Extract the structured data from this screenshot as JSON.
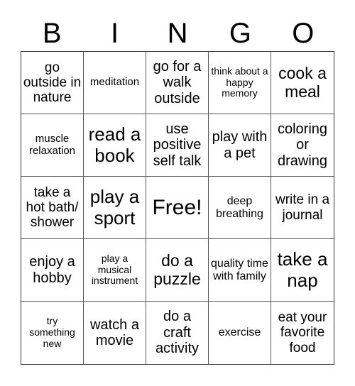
{
  "header": [
    "B",
    "I",
    "N",
    "G",
    "O"
  ],
  "cells": [
    "go outside in nature",
    "meditation",
    "go for a walk outside",
    "think about a happy memory",
    "cook a meal",
    "muscle relaxation",
    "read a book",
    "use positive self talk",
    "play with a pet",
    "coloring or drawing",
    "take a hot bath/ shower",
    "play a sport",
    "Free!",
    "deep breathing",
    "write in a journal",
    "enjoy a hobby",
    "play a musical instrument",
    "do a puzzle",
    "quality time with family",
    "take a nap",
    "try something new",
    "watch a movie",
    "do a craft activity",
    "exercise",
    "eat your favorite food"
  ]
}
